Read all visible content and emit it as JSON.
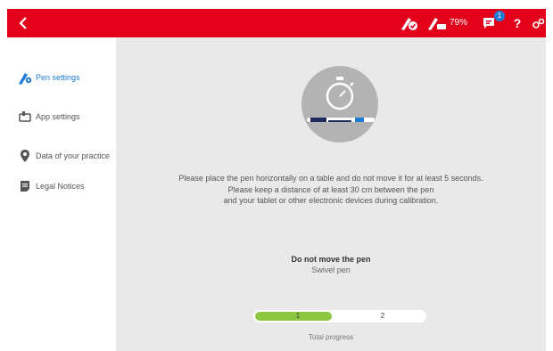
{
  "topbar": {
    "battery_label": "79%",
    "notification_count": "1",
    "help_label": "?",
    "brand_color": "#e2001a",
    "icons": [
      "back-icon",
      "pen-connected-icon",
      "pen-battery-icon",
      "chat-icon",
      "help-icon",
      "settings-icon"
    ]
  },
  "sidebar": {
    "items": [
      {
        "label": "Pen settings",
        "icon": "pen-settings-icon",
        "active": true
      },
      {
        "label": "App settings",
        "icon": "app-settings-icon",
        "active": false
      },
      {
        "label": "Data of your practice",
        "icon": "location-pin-icon",
        "active": false
      },
      {
        "label": "Legal Notices",
        "icon": "document-icon",
        "active": false
      }
    ]
  },
  "main": {
    "illustration": "stopwatch-pen-icon",
    "instructions": [
      "Please place the pen horizontally on a table and do not move it for at least 5 seconds.",
      "Please keep a distance of at least 30 cm between the pen",
      "and your tablet or other electronic devices during calibration."
    ],
    "status_title": "Do not move the pen",
    "status_subtitle": "Swivel pen",
    "progress": {
      "steps": [
        "1",
        "2"
      ],
      "current_step": 1,
      "fraction": 0.45,
      "label": "Total progress",
      "fill_color": "#8cc63f"
    }
  }
}
